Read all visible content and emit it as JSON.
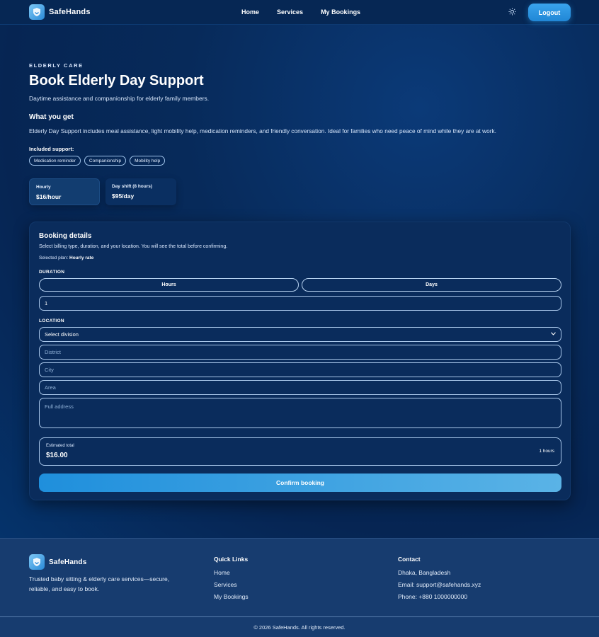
{
  "brand": {
    "name": "SafeHands",
    "accent": "#2a8ad8"
  },
  "nav": {
    "links": [
      "Home",
      "Services",
      "My Bookings"
    ],
    "theme_icon": "sun-icon",
    "logout_label": "Logout"
  },
  "hero": {
    "eyebrow": "ELDERLY CARE",
    "title": "Book Elderly Day Support",
    "subtitle": "Daytime assistance and companionship for elderly family members.",
    "what_heading": "What you get",
    "what_desc": "Elderly Day Support includes meal assistance, light mobility help, medication reminders, and friendly conversation. Ideal for families who need peace of mind while they are at work.",
    "included_label": "Included support:",
    "chips": [
      "Medication reminder",
      "Companionship",
      "Mobility help"
    ]
  },
  "plans": [
    {
      "name": "Hourly",
      "price": "$16/hour"
    },
    {
      "name": "Day shift (8 hours)",
      "price": "$95/day"
    }
  ],
  "booking": {
    "title": "Booking details",
    "subtitle": "Select billing type, duration, and your location. You will see the total before confirming.",
    "selected_plan_label": "Selected plan:",
    "selected_plan_value": "Hourly rate",
    "duration_label": "DURATION",
    "duration_options": [
      "Hours",
      "Days"
    ],
    "duration_value": "1",
    "location_label": "LOCATION",
    "division_value": "Select division",
    "district_placeholder": "District",
    "city_placeholder": "City",
    "area_placeholder": "Area",
    "address_placeholder": "Full address",
    "estimated_label": "Estimated total",
    "estimated_value": "$16.00",
    "estimated_hours": "1 hours",
    "confirm_label": "Confirm booking"
  },
  "footer": {
    "brand": "SafeHands",
    "description": "Trusted baby sitting & elderly care services—secure, reliable, and easy to book.",
    "quick_links_heading": "Quick Links",
    "quick_links": [
      "Home",
      "Services",
      "My Bookings"
    ],
    "contact_heading": "Contact",
    "contact": [
      "Dhaka, Bangladesh",
      "Email: support@safehands.xyz",
      "Phone: +880 1000000000"
    ],
    "copyright": "© 2026 SafeHands. All rights reserved."
  }
}
